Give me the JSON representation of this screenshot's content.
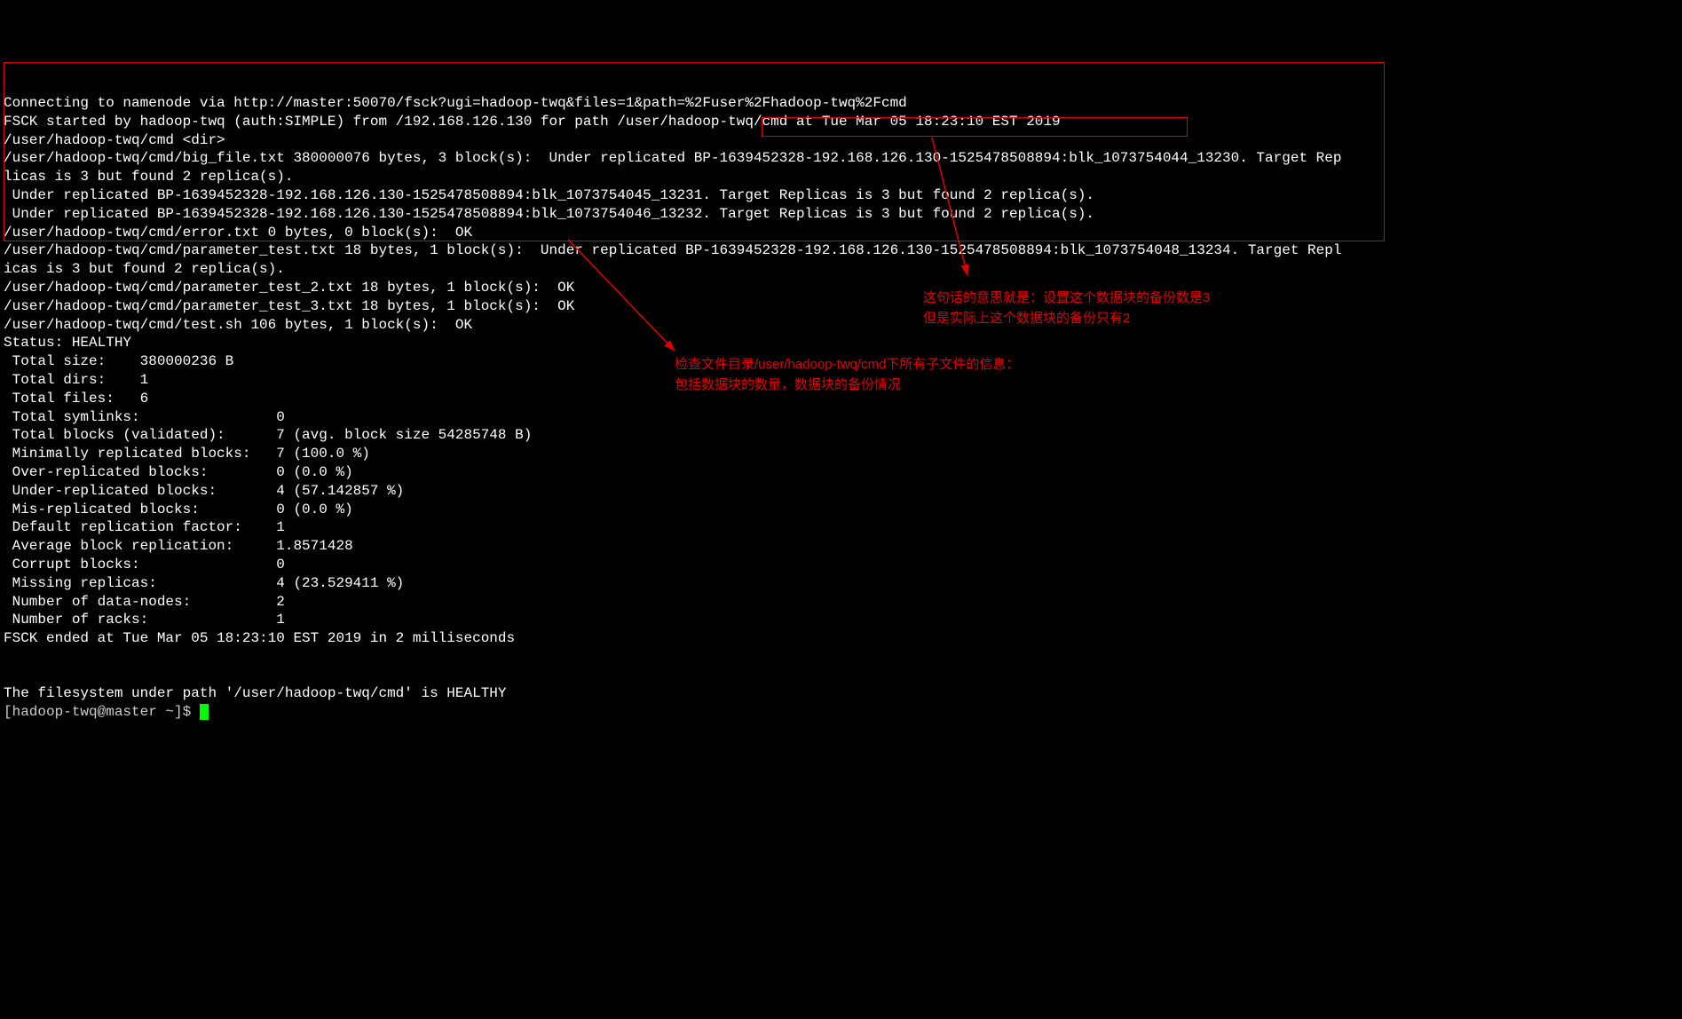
{
  "header": {
    "line1": "Connecting to namenode via http://master:50070/fsck?ugi=hadoop-twq&files=1&path=%2Fuser%2Fhadoop-twq%2Fcmd",
    "line2": "FSCK started by hadoop-twq (auth:SIMPLE) from /192.168.126.130 for path /user/hadoop-twq/cmd at Tue Mar 05 18:23:10 EST 2019",
    "line3": "/user/hadoop-twq/cmd <dir>"
  },
  "files": {
    "l1": "/user/hadoop-twq/cmd/big_file.txt 380000076 bytes, 3 block(s):  Under replicated BP-1639452328-192.168.126.130-1525478508894:blk_1073754044_13230. Target Rep",
    "l2": "licas is 3 but found 2 replica(s).",
    "l3": " Under replicated BP-1639452328-192.168.126.130-1525478508894:blk_1073754045_13231. Target Replicas is 3 but found 2 replica(s).",
    "l4": " Under replicated BP-1639452328-192.168.126.130-1525478508894:blk_1073754046_13232. Target Replicas is 3 but found 2 replica(s).",
    "l5": "/user/hadoop-twq/cmd/error.txt 0 bytes, 0 block(s):  OK",
    "l6": "/user/hadoop-twq/cmd/parameter_test.txt 18 bytes, 1 block(s):  Under replicated BP-1639452328-192.168.126.130-1525478508894:blk_1073754048_13234. Target Repl",
    "l7": "icas is 3 but found 2 replica(s).",
    "l8": "/user/hadoop-twq/cmd/parameter_test_2.txt 18 bytes, 1 block(s):  OK",
    "l9": "/user/hadoop-twq/cmd/parameter_test_3.txt 18 bytes, 1 block(s):  OK",
    "l10": "/user/hadoop-twq/cmd/test.sh 106 bytes, 1 block(s):  OK"
  },
  "status": {
    "healthy": "Status: HEALTHY",
    "total_size": " Total size:    380000236 B",
    "total_dirs": " Total dirs:    1",
    "total_files": " Total files:   6",
    "total_symlinks": " Total symlinks:                0",
    "total_blocks": " Total blocks (validated):      7 (avg. block size 54285748 B)",
    "min_rep": " Minimally replicated blocks:   7 (100.0 %)",
    "over_rep": " Over-replicated blocks:        0 (0.0 %)",
    "under_rep": " Under-replicated blocks:       4 (57.142857 %)",
    "mis_rep": " Mis-replicated blocks:         0 (0.0 %)",
    "def_rep": " Default replication factor:    1",
    "avg_rep": " Average block replication:     1.8571428",
    "corrupt": " Corrupt blocks:                0",
    "missing": " Missing replicas:              4 (23.529411 %)",
    "datanodes": " Number of data-nodes:          2",
    "racks": " Number of racks:               1",
    "ended": "FSCK ended at Tue Mar 05 18:23:10 EST 2019 in 2 milliseconds",
    "blank": "",
    "fs_healthy": "The filesystem under path '/user/hadoop-twq/cmd' is HEALTHY",
    "prompt": "[hadoop-twq@master ~]$ "
  },
  "annotations": {
    "a1_line1": "这句话的意思就是：设置这个数据块的备份数是3",
    "a1_line2": "但是实际上这个数据块的备份只有2",
    "a2_line1": "检查文件目录/user/hadoop-twq/cmd下所有子文件的信息：",
    "a2_line2": "包括数据块的数量，数据块的备份情况"
  }
}
